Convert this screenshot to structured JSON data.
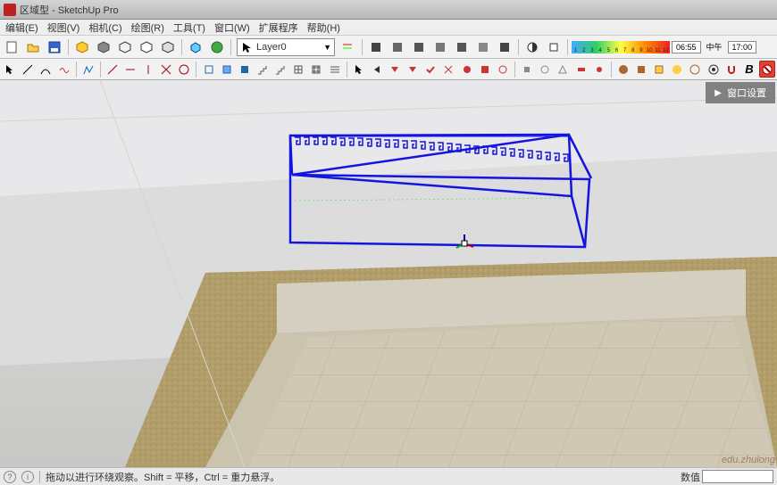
{
  "title": "区域型 - SketchUp Pro",
  "menu": [
    "编辑(E)",
    "视图(V)",
    "相机(C)",
    "绘图(R)",
    "工具(T)",
    "窗口(W)",
    "扩展程序",
    "帮助(H)"
  ],
  "layer": {
    "label": "Layer0"
  },
  "gradient_labels": [
    "1",
    "2",
    "3",
    "4",
    "5",
    "6",
    "7",
    "8",
    "9",
    "10",
    "11",
    "12"
  ],
  "time": {
    "start": "06:55",
    "mid": "中午",
    "end": "17:00"
  },
  "settings_panel": "窗口设置",
  "status": {
    "hint": "拖动以进行环绕观察。Shift = 平移，Ctrl = 重力悬浮。",
    "dim_label": "数值"
  },
  "watermark": "edu.zhulong"
}
